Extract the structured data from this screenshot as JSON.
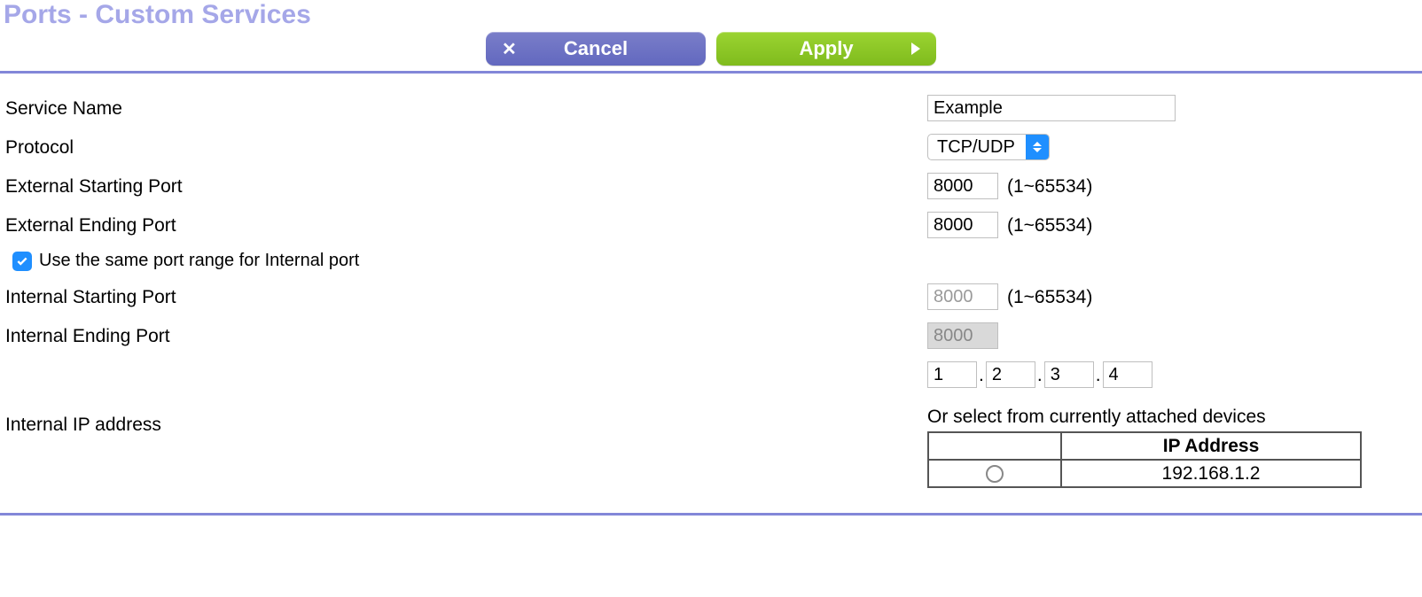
{
  "title": "Ports - Custom Services",
  "buttons": {
    "cancel": "Cancel",
    "apply": "Apply"
  },
  "labels": {
    "service_name": "Service Name",
    "protocol": "Protocol",
    "ext_start": "External Starting Port",
    "ext_end": "External Ending Port",
    "same_range": "Use the same port range for Internal port",
    "int_start": "Internal Starting Port",
    "int_end": "Internal Ending Port",
    "int_ip": "Internal IP address",
    "or_select": "Or select from currently attached devices",
    "ip_address_header": "IP Address"
  },
  "values": {
    "service_name": "Example",
    "protocol": "TCP/UDP",
    "ext_start": "8000",
    "ext_end": "8000",
    "int_start": "8000",
    "int_end": "8000",
    "ip_oct1": "1",
    "ip_oct2": "2",
    "ip_oct3": "3",
    "ip_oct4": "4",
    "same_range_checked": true
  },
  "hints": {
    "port_range": "(1~65534)"
  },
  "devices": [
    {
      "ip": "192.168.1.2"
    }
  ]
}
